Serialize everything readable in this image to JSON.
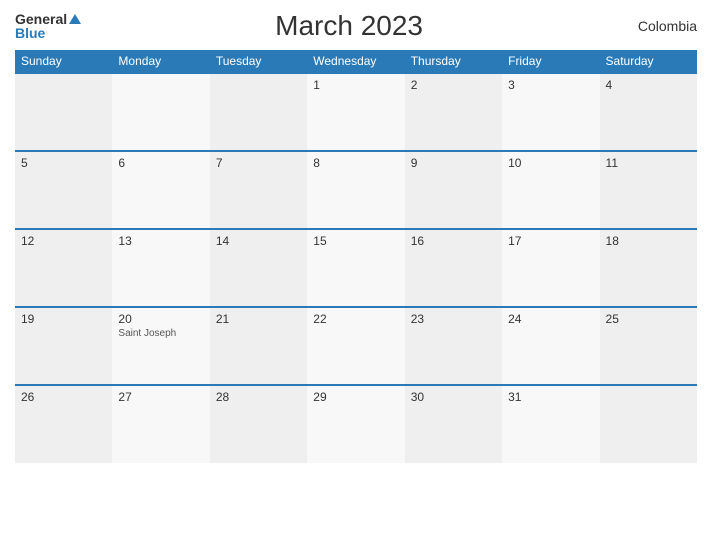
{
  "header": {
    "logo": {
      "general_text": "General",
      "blue_text": "Blue"
    },
    "title": "March 2023",
    "country": "Colombia"
  },
  "weekdays": [
    "Sunday",
    "Monday",
    "Tuesday",
    "Wednesday",
    "Thursday",
    "Friday",
    "Saturday"
  ],
  "weeks": [
    [
      {
        "day": "",
        "holiday": ""
      },
      {
        "day": "",
        "holiday": ""
      },
      {
        "day": "",
        "holiday": ""
      },
      {
        "day": "1",
        "holiday": ""
      },
      {
        "day": "2",
        "holiday": ""
      },
      {
        "day": "3",
        "holiday": ""
      },
      {
        "day": "4",
        "holiday": ""
      }
    ],
    [
      {
        "day": "5",
        "holiday": ""
      },
      {
        "day": "6",
        "holiday": ""
      },
      {
        "day": "7",
        "holiday": ""
      },
      {
        "day": "8",
        "holiday": ""
      },
      {
        "day": "9",
        "holiday": ""
      },
      {
        "day": "10",
        "holiday": ""
      },
      {
        "day": "11",
        "holiday": ""
      }
    ],
    [
      {
        "day": "12",
        "holiday": ""
      },
      {
        "day": "13",
        "holiday": ""
      },
      {
        "day": "14",
        "holiday": ""
      },
      {
        "day": "15",
        "holiday": ""
      },
      {
        "day": "16",
        "holiday": ""
      },
      {
        "day": "17",
        "holiday": ""
      },
      {
        "day": "18",
        "holiday": ""
      }
    ],
    [
      {
        "day": "19",
        "holiday": ""
      },
      {
        "day": "20",
        "holiday": "Saint Joseph"
      },
      {
        "day": "21",
        "holiday": ""
      },
      {
        "day": "22",
        "holiday": ""
      },
      {
        "day": "23",
        "holiday": ""
      },
      {
        "day": "24",
        "holiday": ""
      },
      {
        "day": "25",
        "holiday": ""
      }
    ],
    [
      {
        "day": "26",
        "holiday": ""
      },
      {
        "day": "27",
        "holiday": ""
      },
      {
        "day": "28",
        "holiday": ""
      },
      {
        "day": "29",
        "holiday": ""
      },
      {
        "day": "30",
        "holiday": ""
      },
      {
        "day": "31",
        "holiday": ""
      },
      {
        "day": "",
        "holiday": ""
      }
    ]
  ]
}
